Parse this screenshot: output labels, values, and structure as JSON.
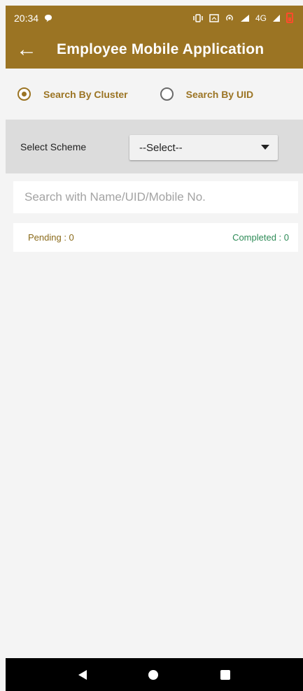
{
  "status_bar": {
    "time": "20:34",
    "network": "4G",
    "icons": [
      "chat-bubble-icon",
      "vibrate-icon",
      "screen-cast-icon",
      "hotspot-icon",
      "signal-icon",
      "battery-low-icon"
    ]
  },
  "app_bar": {
    "title": "Employee Mobile Application",
    "back_icon": "back-arrow-icon",
    "color": "#9b7423"
  },
  "search_mode": {
    "options": [
      {
        "label": "Search By Cluster",
        "selected": true
      },
      {
        "label": "Search By UID",
        "selected": false
      }
    ]
  },
  "scheme": {
    "label": "Select Scheme",
    "selected_value": "--Select--"
  },
  "search": {
    "placeholder": "Search with Name/UID/Mobile No.",
    "value": ""
  },
  "counts": {
    "pending": "Pending : 0",
    "completed": "Completed : 0"
  },
  "nav_bar": {
    "icons": [
      "back-triangle-icon",
      "home-circle-icon",
      "recents-square-icon"
    ]
  }
}
